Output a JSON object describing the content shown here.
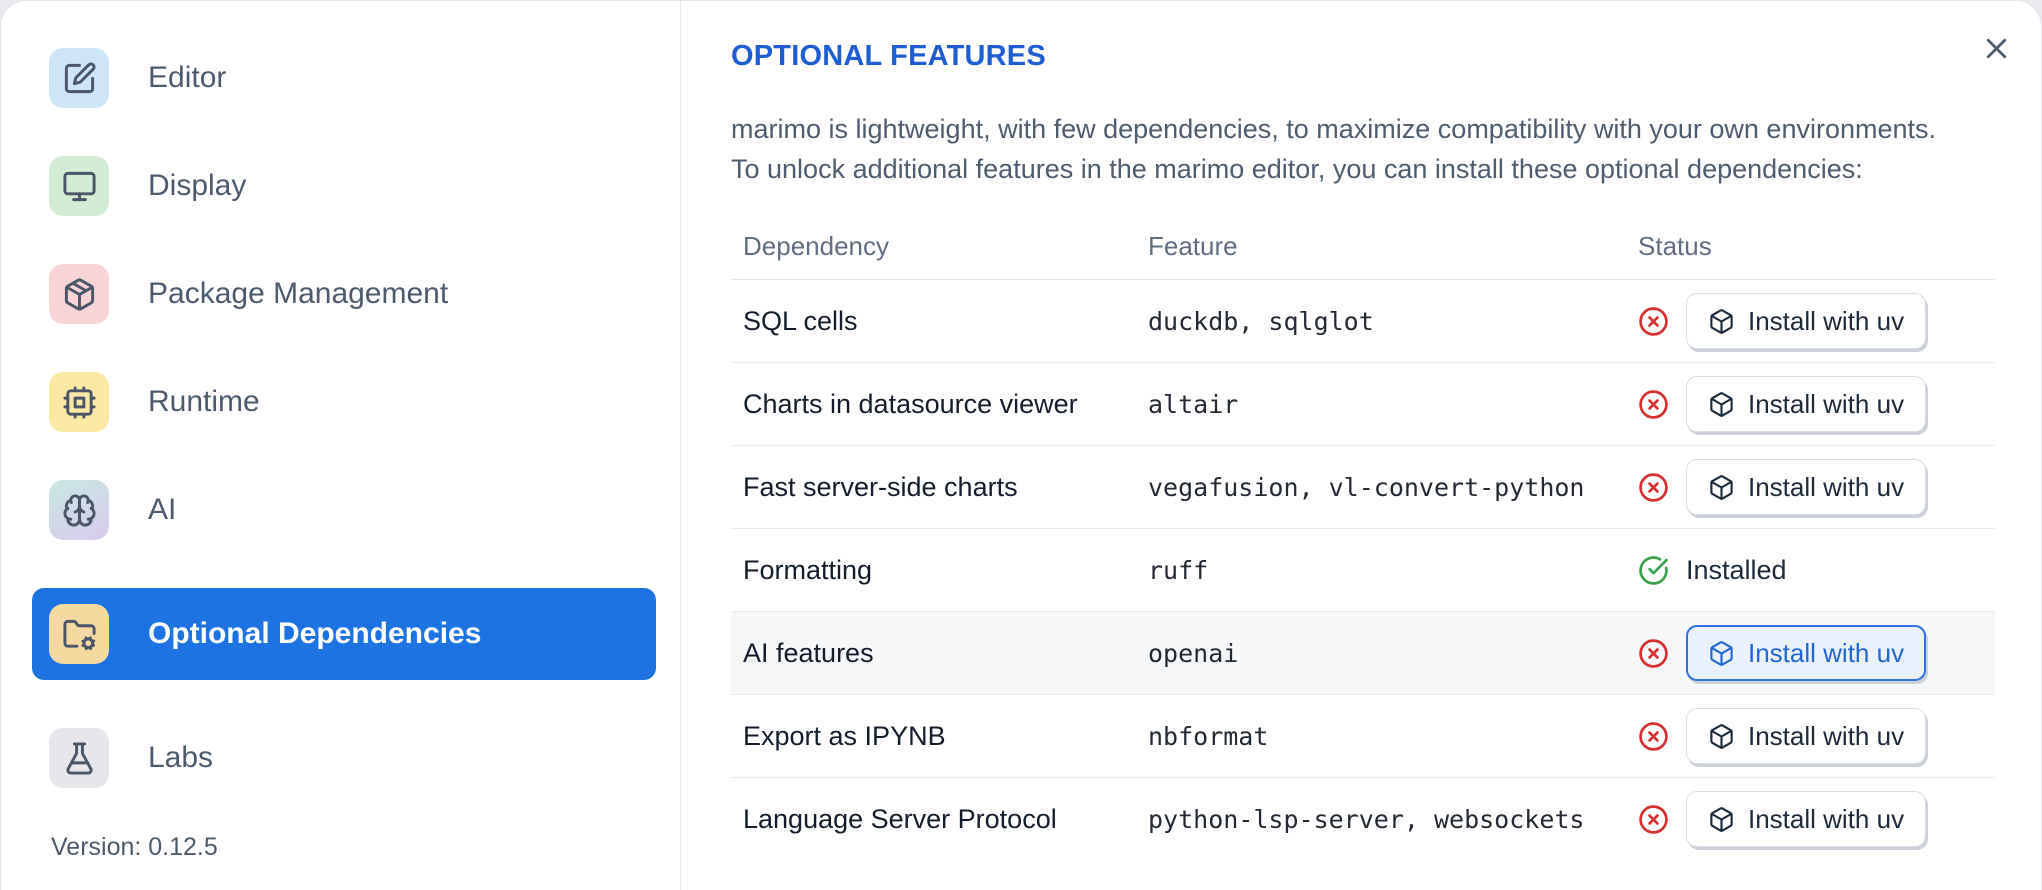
{
  "dialog": {
    "sidebar": {
      "items": [
        {
          "label": "Editor",
          "icon": "square-pen",
          "icon_bg": "#cce6f8",
          "selected": false
        },
        {
          "label": "Display",
          "icon": "monitor",
          "icon_bg": "#d3ecd4",
          "selected": false
        },
        {
          "label": "Package Management",
          "icon": "package",
          "icon_bg": "#f9d4d6",
          "selected": false
        },
        {
          "label": "Runtime",
          "icon": "cpu",
          "icon_bg": "#fae8a3",
          "selected": false
        },
        {
          "label": "AI",
          "icon": "brain",
          "icon_bg": "linear-gradient(155deg,#c7e9e3 0%,#d9c9ee 100%)",
          "selected": false
        },
        {
          "label": "Optional Dependencies",
          "icon": "folder-cog",
          "icon_bg": "#f6d8a1",
          "selected": true
        },
        {
          "label": "Labs",
          "icon": "flask-conical",
          "icon_bg": "#e7e7eb",
          "selected": false
        }
      ],
      "version_label": "Version: 0.12.5"
    },
    "main": {
      "title": "OPTIONAL FEATURES",
      "description_line1": "marimo is lightweight, with few dependencies, to maximize compatibility with your own environments.",
      "description_line2": "To unlock additional features in the marimo editor, you can install these optional dependencies:",
      "table": {
        "headers": [
          "Dependency",
          "Feature",
          "Status"
        ],
        "install_button_label": "Install with uv",
        "installed_label": "Installed",
        "rows": [
          {
            "dependency": "SQL cells",
            "feature": "duckdb, sqlglot",
            "installed": false,
            "highlighted": false
          },
          {
            "dependency": "Charts in datasource viewer",
            "feature": "altair",
            "installed": false,
            "highlighted": false
          },
          {
            "dependency": "Fast server-side charts",
            "feature": "vegafusion, vl-convert-python",
            "installed": false,
            "highlighted": false
          },
          {
            "dependency": "Formatting",
            "feature": "ruff",
            "installed": true,
            "highlighted": false
          },
          {
            "dependency": "AI features",
            "feature": "openai",
            "installed": false,
            "highlighted": true
          },
          {
            "dependency": "Export as IPYNB",
            "feature": "nbformat",
            "installed": false,
            "highlighted": false
          },
          {
            "dependency": "Language Server Protocol",
            "feature": "python-lsp-server, websockets",
            "installed": false,
            "highlighted": false
          }
        ]
      }
    },
    "colors": {
      "selected_item_bg": "#1e73e3",
      "title_blue": "#1d5fd2",
      "installed_green": "#37a24b",
      "not_installed_red": "#d63030",
      "highlight_button_blue": "#2f72dd",
      "row_highlight_bg": "#f6f7f9"
    }
  }
}
